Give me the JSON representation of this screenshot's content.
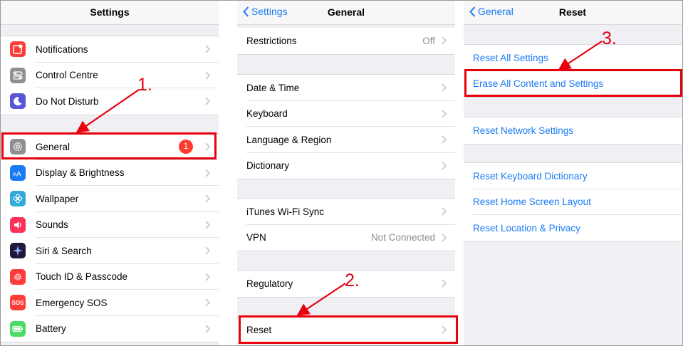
{
  "settings": {
    "title": "Settings",
    "group1": [
      {
        "label": "Notifications",
        "icon": "notifications-icon",
        "color": "#fc3d39"
      },
      {
        "label": "Control Centre",
        "icon": "control-centre-icon",
        "color": "#8e8e93"
      },
      {
        "label": "Do Not Disturb",
        "icon": "moon-icon",
        "color": "#5856d6"
      }
    ],
    "group2": [
      {
        "label": "General",
        "icon": "gear-icon",
        "color": "#8e8e93",
        "badge": "1"
      },
      {
        "label": "Display & Brightness",
        "icon": "display-icon",
        "color": "#1a7cf5"
      },
      {
        "label": "Wallpaper",
        "icon": "wallpaper-icon",
        "color": "#34aadc"
      },
      {
        "label": "Sounds",
        "icon": "speaker-icon",
        "color": "#fc3158"
      },
      {
        "label": "Siri & Search",
        "icon": "siri-icon",
        "color": "#1c1c3a"
      },
      {
        "label": "Touch ID & Passcode",
        "icon": "fingerprint-icon",
        "color": "#fc3d39"
      },
      {
        "label": "Emergency SOS",
        "icon": "sos-icon",
        "color": "#fc3d39",
        "icon_text": "SOS"
      },
      {
        "label": "Battery",
        "icon": "battery-icon",
        "color": "#4cd964"
      }
    ]
  },
  "general": {
    "back": "Settings",
    "title": "General",
    "group1": [
      {
        "label": "Restrictions",
        "value": "Off"
      }
    ],
    "group2": [
      {
        "label": "Date & Time"
      },
      {
        "label": "Keyboard"
      },
      {
        "label": "Language & Region"
      },
      {
        "label": "Dictionary"
      }
    ],
    "group3": [
      {
        "label": "iTunes Wi-Fi Sync"
      },
      {
        "label": "VPN",
        "value": "Not Connected"
      }
    ],
    "group4": [
      {
        "label": "Regulatory"
      }
    ],
    "group5": [
      {
        "label": "Reset"
      }
    ]
  },
  "reset": {
    "back": "General",
    "title": "Reset",
    "group1": [
      {
        "label": "Reset All Settings"
      },
      {
        "label": "Erase All Content and Settings"
      }
    ],
    "group2": [
      {
        "label": "Reset Network Settings"
      }
    ],
    "group3": [
      {
        "label": "Reset Keyboard Dictionary"
      },
      {
        "label": "Reset Home Screen Layout"
      },
      {
        "label": "Reset Location & Privacy"
      }
    ]
  },
  "annotations": {
    "step1": "1.",
    "step2": "2.",
    "step3": "3.",
    "color": "#e8000d"
  },
  "colors": {
    "link_blue": "#1a7cf5",
    "badge_red": "#ff3b30",
    "group_bg": "#efeff4"
  }
}
